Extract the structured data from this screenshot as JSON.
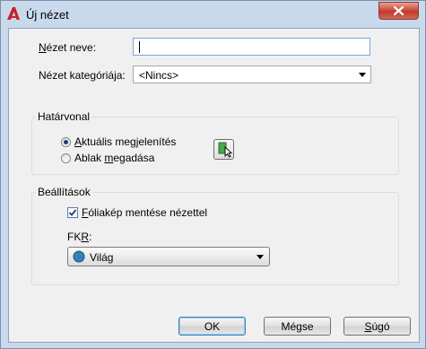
{
  "window": {
    "title": "Új nézet"
  },
  "form": {
    "view_name_label_u": "N",
    "view_name_label_rest": "ézet neve:",
    "view_name_value": "",
    "category_label_pre": "Nézet kate",
    "category_label_u": "g",
    "category_label_post": "óriája:",
    "category_value": "<Nincs>"
  },
  "boundary": {
    "title": "Határvonal",
    "option_current_u": "A",
    "option_current_rest": "ktuális megjelenítés",
    "option_window_pre": "Ablak ",
    "option_window_u": "m",
    "option_window_post": "egadása",
    "selected": "current"
  },
  "settings": {
    "title": "Beállítások",
    "snapshot_u": "F",
    "snapshot_rest": "óliakép mentése nézettel",
    "snapshot_checked": true,
    "ucs_label_pre": "FK",
    "ucs_label_u": "R",
    "ucs_label_post": ":",
    "ucs_value": "Világ"
  },
  "buttons": {
    "ok": "OK",
    "cancel": "Mégse",
    "help_u": "S",
    "help_rest": "úgó"
  }
}
